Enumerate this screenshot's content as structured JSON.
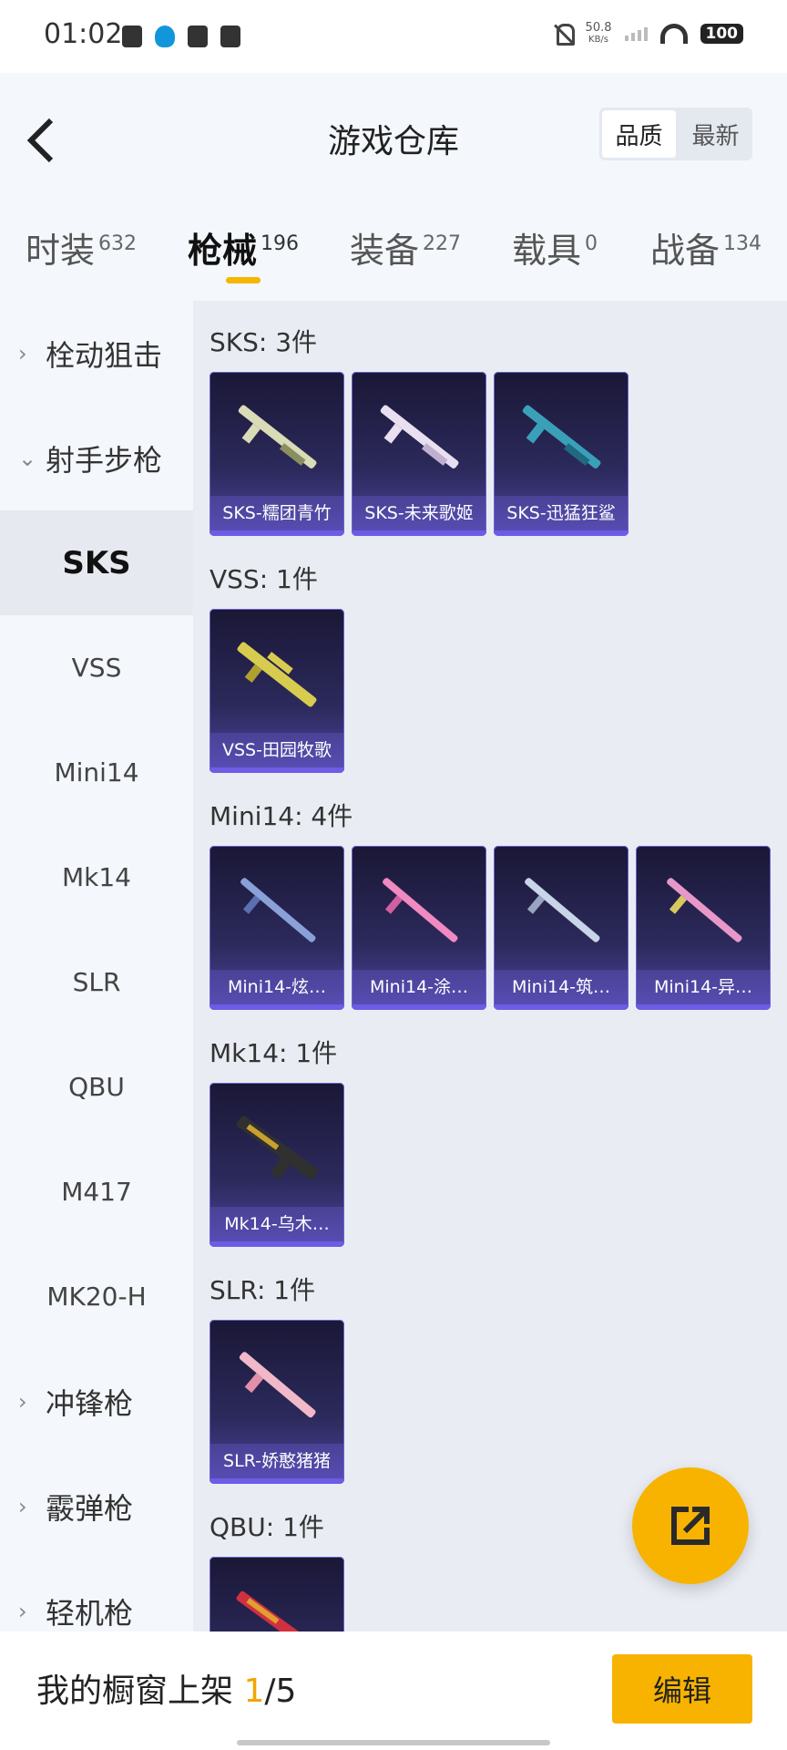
{
  "status_bar": {
    "time": "01:02",
    "net_speed_value": "50.8",
    "net_speed_unit": "KB/s",
    "battery": "100",
    "icons_left": [
      "clipboard-check-icon",
      "qq-icon",
      "card-icon",
      "tiktok-icon"
    ],
    "icons_right": [
      "mute-icon",
      "signal-icon",
      "wifi-icon",
      "battery-icon"
    ]
  },
  "header": {
    "title": "游戏仓库",
    "sort_options": [
      "品质",
      "最新"
    ],
    "sort_selected": "品质"
  },
  "tabs": [
    {
      "label": "时装",
      "count": "632"
    },
    {
      "label": "枪械",
      "count": "196"
    },
    {
      "label": "装备",
      "count": "227"
    },
    {
      "label": "载具",
      "count": "0"
    },
    {
      "label": "战备",
      "count": "134"
    }
  ],
  "active_tab": "枪械",
  "sidebar": {
    "items": [
      {
        "label": "栓动狙击",
        "kind": "group",
        "expanded": false
      },
      {
        "label": "射手步枪",
        "kind": "group",
        "expanded": true
      },
      {
        "label": "SKS",
        "kind": "item",
        "selected": true
      },
      {
        "label": "VSS",
        "kind": "item"
      },
      {
        "label": "Mini14",
        "kind": "item"
      },
      {
        "label": "Mk14",
        "kind": "item"
      },
      {
        "label": "SLR",
        "kind": "item"
      },
      {
        "label": "QBU",
        "kind": "item"
      },
      {
        "label": "M417",
        "kind": "item"
      },
      {
        "label": "MK20-H",
        "kind": "item"
      },
      {
        "label": "冲锋枪",
        "kind": "group",
        "expanded": false
      },
      {
        "label": "霰弹枪",
        "kind": "group",
        "expanded": false
      },
      {
        "label": "轻机枪",
        "kind": "group",
        "expanded": false
      }
    ]
  },
  "sections": [
    {
      "title": "SKS: 3件",
      "items": [
        "SKS-糯团青竹",
        "SKS-未来歌姬",
        "SKS-迅猛狂鲨"
      ]
    },
    {
      "title": "VSS: 1件",
      "items": [
        "VSS-田园牧歌"
      ]
    },
    {
      "title": "Mini14: 4件",
      "items": [
        "Mini14-炫…",
        "Mini14-涂…",
        "Mini14-筑…",
        "Mini14-异…"
      ]
    },
    {
      "title": "Mk14: 1件",
      "items": [
        "Mk14-乌木…"
      ]
    },
    {
      "title": "SLR: 1件",
      "items": [
        "SLR-娇憨猪猪"
      ]
    },
    {
      "title": "QBU: 1件",
      "items": [
        ""
      ]
    }
  ],
  "fab": {
    "icon": "share-external-icon"
  },
  "footer": {
    "showcase_label": "我的橱窗上架 ",
    "showcase_current": "1",
    "showcase_total": "/5",
    "edit_label": "编辑"
  },
  "colors": {
    "accent": "#f7b300",
    "card_bg": "#2c2a5c",
    "card_border": "#6a5fd0",
    "gun_colors": [
      "#d9dcb6",
      "#e8e0f0",
      "#3aa0b8",
      "#d8cc50",
      "#8aa0d8",
      "#f08ac0",
      "#c8d4e8",
      "#e898c8",
      "#303030",
      "#f0b8c8",
      "#d03040"
    ]
  }
}
